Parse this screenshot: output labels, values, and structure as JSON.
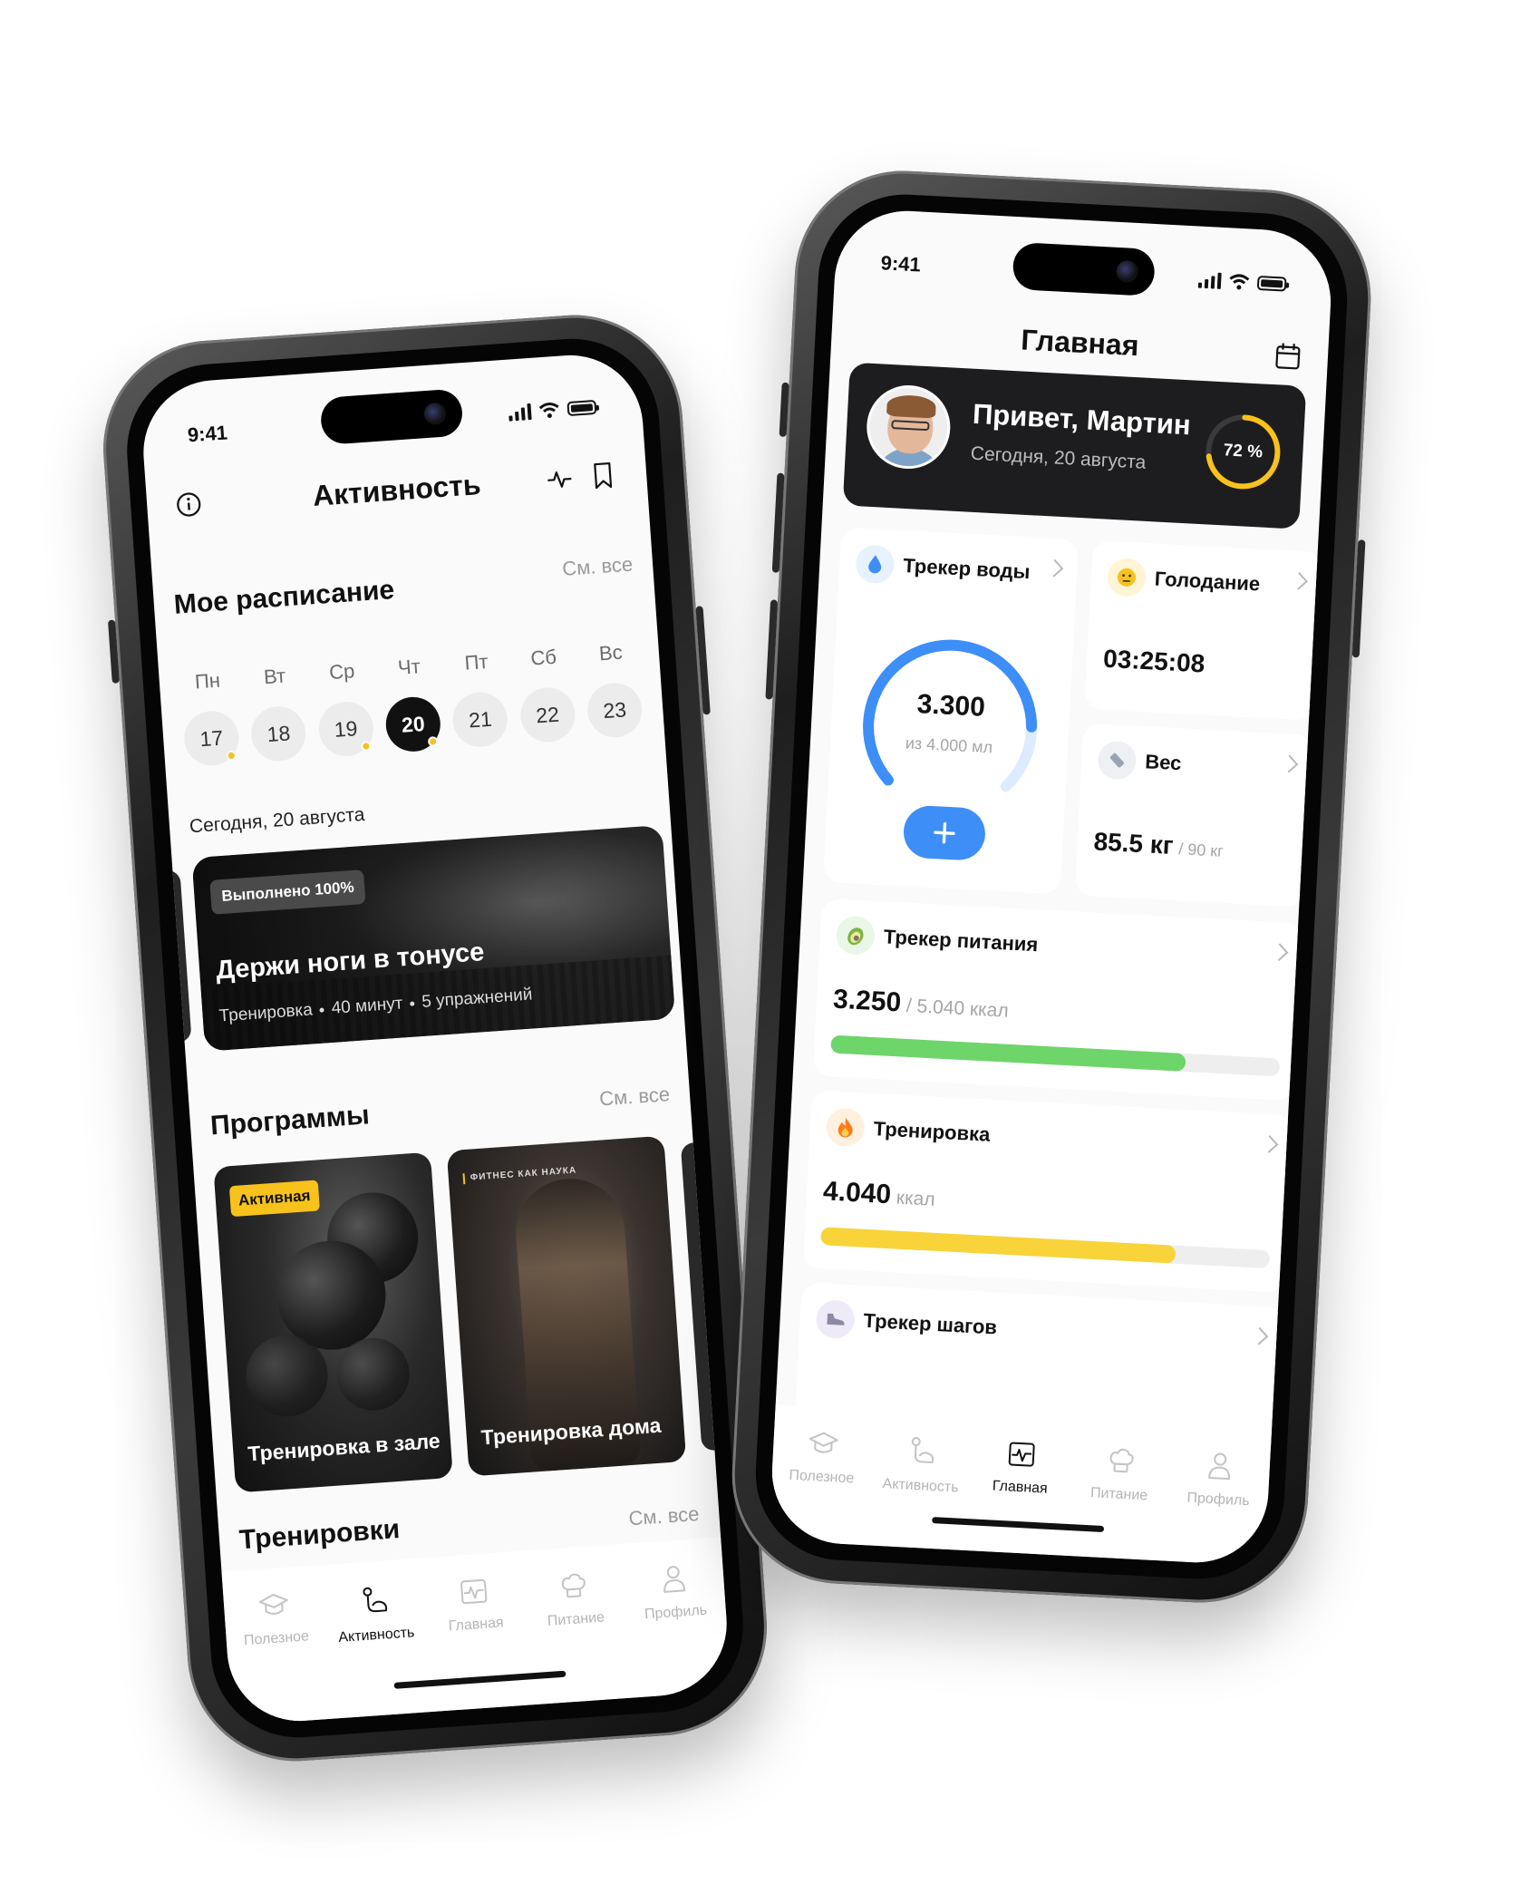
{
  "status_time": "9:41",
  "left": {
    "header": {
      "title": "Активность"
    },
    "schedule": {
      "title": "Мое расписание",
      "see_all": "См. все",
      "days": [
        {
          "label": "Пн",
          "num": "17",
          "dot": true,
          "active": false
        },
        {
          "label": "Вт",
          "num": "18",
          "dot": false,
          "active": false
        },
        {
          "label": "Ср",
          "num": "19",
          "dot": true,
          "active": false
        },
        {
          "label": "Чт",
          "num": "20",
          "dot": true,
          "active": true
        },
        {
          "label": "Пт",
          "num": "21",
          "dot": false,
          "active": false
        },
        {
          "label": "Сб",
          "num": "22",
          "dot": false,
          "active": false
        },
        {
          "label": "Вс",
          "num": "23",
          "dot": false,
          "active": false
        }
      ],
      "today_label": "Сегодня, 20 августа"
    },
    "workout_card": {
      "badge": "Выполнено 100%",
      "title": "Держи ноги в тонусе",
      "meta": [
        "Тренировка",
        "40 минут",
        "5 упражнений"
      ]
    },
    "programs": {
      "title": "Программы",
      "see_all": "См. все",
      "items": [
        {
          "title": "Тренировка в зале",
          "badge": "Активная"
        },
        {
          "title": "Тренировка дома",
          "logo": "ФИТНЕС КАК НАУКА"
        }
      ]
    },
    "workouts": {
      "title": "Тренировки",
      "see_all": "См. все"
    },
    "tabs": [
      {
        "label": "Полезное",
        "icon": "graduation-cap-icon",
        "active": false
      },
      {
        "label": "Активность",
        "icon": "biceps-icon",
        "active": true
      },
      {
        "label": "Главная",
        "icon": "pulse-board-icon",
        "active": false
      },
      {
        "label": "Питание",
        "icon": "chef-hat-icon",
        "active": false
      },
      {
        "label": "Профиль",
        "icon": "user-icon",
        "active": false
      }
    ]
  },
  "right": {
    "header": {
      "title": "Главная"
    },
    "greeting": {
      "hello": "Привет, Мартин",
      "date": "Сегодня, 20 августа",
      "progress_label": "72 %",
      "progress": 0.72
    },
    "water": {
      "title": "Трекер воды",
      "value": "3.300",
      "goal": "из 4.000 мл",
      "fraction": 0.825
    },
    "fasting": {
      "title": "Голодание",
      "value": "03:25:08"
    },
    "weight": {
      "title": "Вес",
      "value": "85.5 кг",
      "goal": "/ 90 кг"
    },
    "nutrition": {
      "title": "Трекер питания",
      "value": "3.250",
      "goal": "/ 5.040 ккал",
      "fraction": 0.79
    },
    "training": {
      "title": "Тренировка",
      "value": "4.040",
      "unit": "ккал",
      "fraction": 0.79
    },
    "steps": {
      "title": "Трекер шагов"
    },
    "tabs": [
      {
        "label": "Полезное",
        "icon": "graduation-cap-icon",
        "active": false
      },
      {
        "label": "Активность",
        "icon": "biceps-icon",
        "active": false
      },
      {
        "label": "Главная",
        "icon": "pulse-board-icon",
        "active": true
      },
      {
        "label": "Питание",
        "icon": "chef-hat-icon",
        "active": false
      },
      {
        "label": "Профиль",
        "icon": "user-icon",
        "active": false
      }
    ]
  },
  "colors": {
    "accent_yellow": "#F7C21B",
    "water_blue": "#3E8EF7",
    "nutrition_green": "#6ED56A",
    "training_yellow": "#F8D43A"
  }
}
